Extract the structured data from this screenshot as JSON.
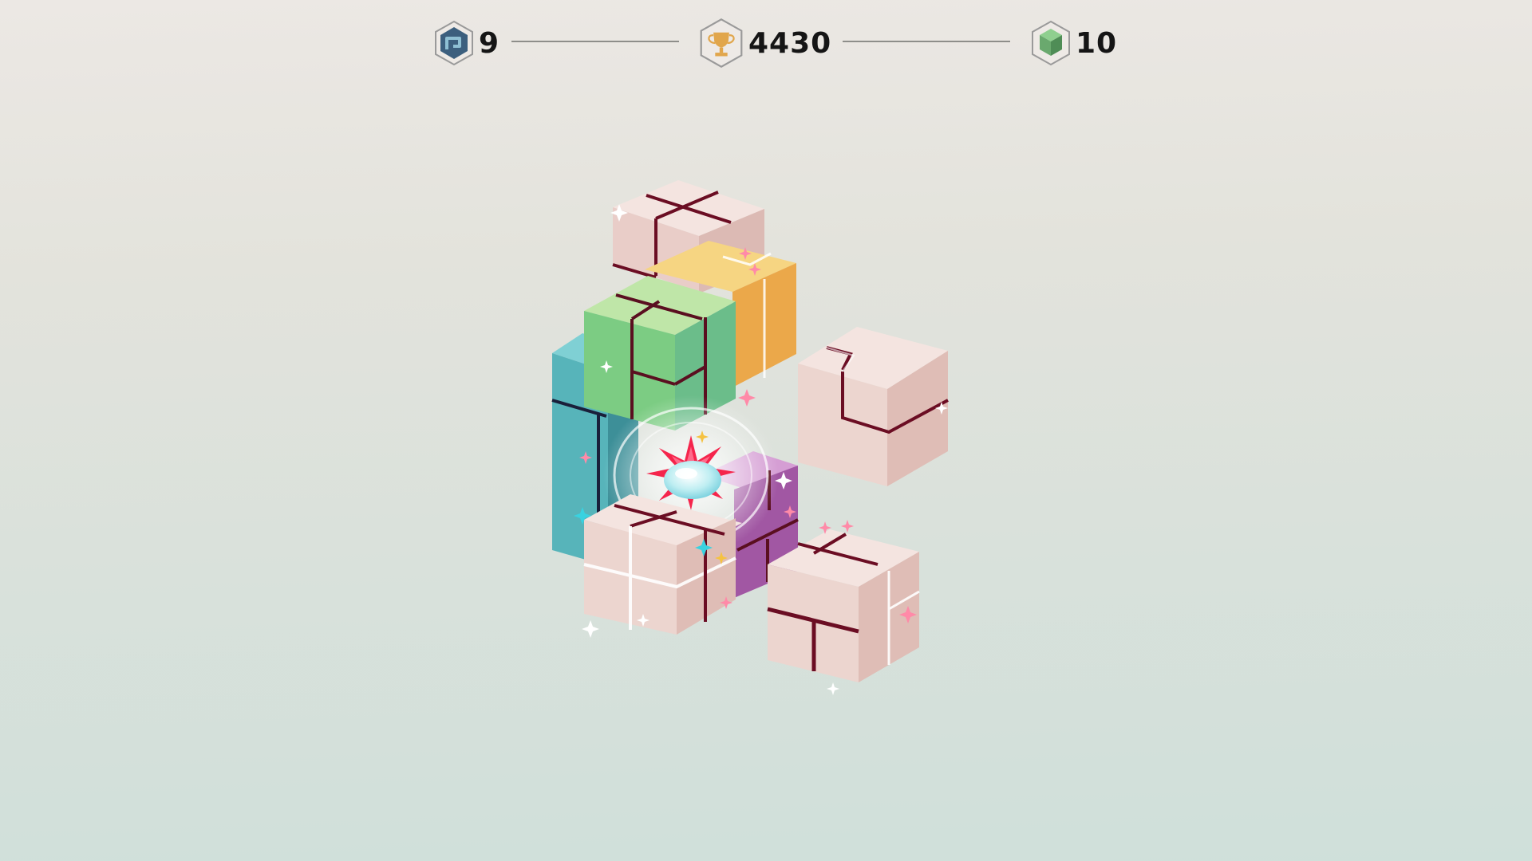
{
  "hud": {
    "moves": {
      "value": "9",
      "icon": "path-hex-icon"
    },
    "score": {
      "value": "4430",
      "icon": "trophy-hex-icon"
    },
    "blocks": {
      "value": "10",
      "icon": "cube-hex-icon"
    }
  },
  "colors": {
    "pink_block": "#ecd5cf",
    "groove": "#6b0d23",
    "green_block": "#7ccc83",
    "yellow_block": "#f5cf76",
    "teal_block": "#56b3b9",
    "purple_block": "#a157a3",
    "burst": "#f5254c"
  }
}
